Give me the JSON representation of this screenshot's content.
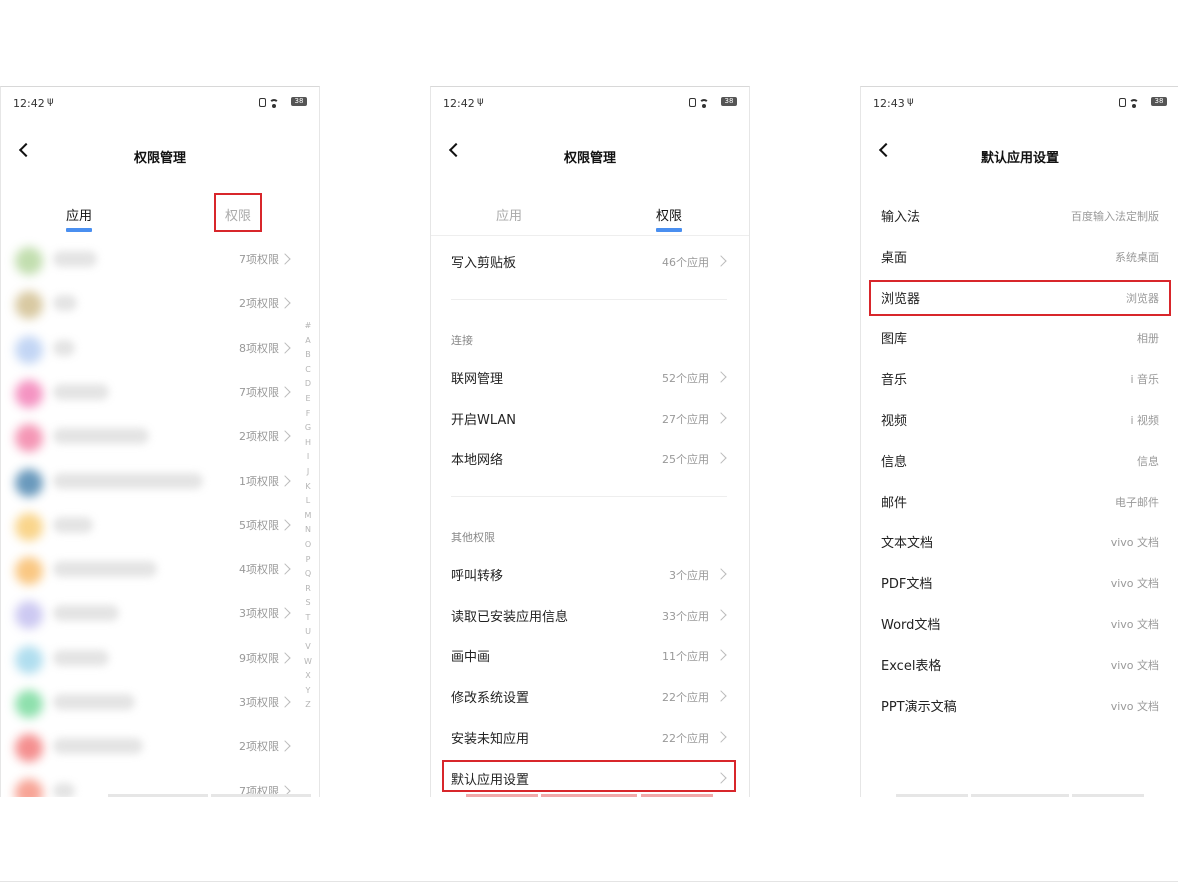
{
  "status": {
    "screen1_time": "12:42",
    "screen2_time": "12:42",
    "screen3_time": "12:43",
    "battery": "38",
    "usb_icon": "usb-icon",
    "nfc_icon": "nfc-icon",
    "wifi_icon": "wifi-icon"
  },
  "screen1": {
    "title": "权限管理",
    "tabs": [
      "应用",
      "权限"
    ],
    "active_tab": 0,
    "rows": [
      {
        "perm": "7项权限",
        "color": "#a8d08d"
      },
      {
        "perm": "2项权限",
        "color": "#c8b27a"
      },
      {
        "perm": "8项权限",
        "color": "#a9c4f0"
      },
      {
        "perm": "7项权限",
        "color": "#f066a8"
      },
      {
        "perm": "2项权限",
        "color": "#f06a96"
      },
      {
        "perm": "1项权限",
        "color": "#2a6ea0"
      },
      {
        "perm": "5项权限",
        "color": "#f7c35a"
      },
      {
        "perm": "4项权限",
        "color": "#f7b04e"
      },
      {
        "perm": "3项权限",
        "color": "#b7b2ec"
      },
      {
        "perm": "9项权限",
        "color": "#8fd0e8"
      },
      {
        "perm": "3项权限",
        "color": "#5ed38a"
      },
      {
        "perm": "2项权限",
        "color": "#f06060"
      },
      {
        "perm": "7项权限",
        "color": "#f47e6a"
      }
    ],
    "alphabet": [
      "#",
      "A",
      "B",
      "C",
      "D",
      "E",
      "F",
      "G",
      "H",
      "I",
      "J",
      "K",
      "L",
      "M",
      "N",
      "O",
      "P",
      "Q",
      "R",
      "S",
      "T",
      "U",
      "V",
      "W",
      "X",
      "Y",
      "Z"
    ]
  },
  "screen2": {
    "title": "权限管理",
    "tabs": [
      "应用",
      "权限"
    ],
    "active_tab": 1,
    "top_row": {
      "label": "写入剪贴板",
      "count": "46个应用"
    },
    "section_connect": "连接",
    "connect_rows": [
      {
        "label": "联网管理",
        "count": "52个应用"
      },
      {
        "label": "开启WLAN",
        "count": "27个应用"
      },
      {
        "label": "本地网络",
        "count": "25个应用"
      }
    ],
    "section_other": "其他权限",
    "other_rows": [
      {
        "label": "呼叫转移",
        "count": "3个应用"
      },
      {
        "label": "读取已安装应用信息",
        "count": "33个应用"
      },
      {
        "label": "画中画",
        "count": "11个应用"
      },
      {
        "label": "修改系统设置",
        "count": "22个应用"
      },
      {
        "label": "安装未知应用",
        "count": "22个应用"
      },
      {
        "label": "默认应用设置",
        "count": ""
      }
    ]
  },
  "screen3": {
    "title": "默认应用设置",
    "rows": [
      {
        "label": "输入法",
        "value": "百度输入法定制版"
      },
      {
        "label": "桌面",
        "value": "系统桌面"
      },
      {
        "label": "浏览器",
        "value": "浏览器"
      },
      {
        "label": "图库",
        "value": "相册"
      },
      {
        "label": "音乐",
        "value": "i 音乐"
      },
      {
        "label": "视频",
        "value": "i 视频"
      },
      {
        "label": "信息",
        "value": "信息"
      },
      {
        "label": "邮件",
        "value": "电子邮件"
      },
      {
        "label": "文本文档",
        "value": "vivo 文档"
      },
      {
        "label": "PDF文档",
        "value": "vivo 文档"
      },
      {
        "label": "Word文档",
        "value": "vivo 文档"
      },
      {
        "label": "Excel表格",
        "value": "vivo 文档"
      },
      {
        "label": "PPT演示文稿",
        "value": "vivo 文档"
      }
    ]
  },
  "colors": {
    "accent": "#4a8ff0",
    "highlight": "#d8262b"
  }
}
